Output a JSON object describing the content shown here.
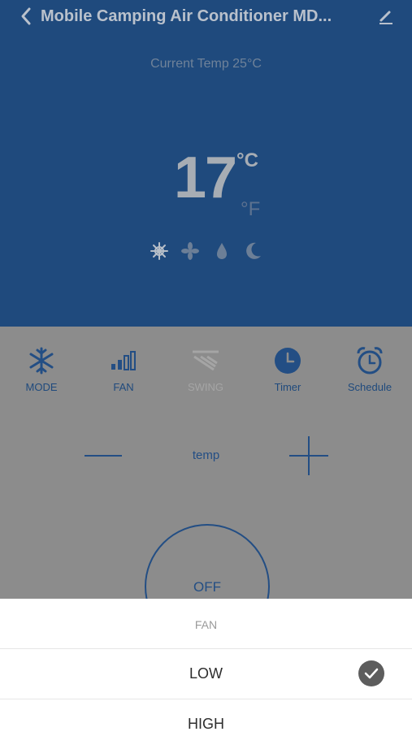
{
  "header": {
    "title": "Mobile Camping Air Conditioner MD...",
    "back_icon": "chevron-left-icon",
    "edit_icon": "pencil-icon"
  },
  "status": {
    "current_temp": "Current Temp 25°C",
    "set_temp": "17",
    "unit_c": "°C",
    "unit_f": "°F",
    "mode_icons": [
      "snowflake-icon",
      "fan-icon",
      "droplet-icon",
      "moon-icon"
    ]
  },
  "controls": [
    {
      "label": "MODE",
      "icon": "snowflake-icon"
    },
    {
      "label": "FAN",
      "icon": "signal-bars-icon"
    },
    {
      "label": "SWING",
      "icon": "swing-icon"
    },
    {
      "label": "Timer",
      "icon": "clock-icon"
    },
    {
      "label": "Schedule",
      "icon": "alarm-icon"
    }
  ],
  "temp_control": {
    "label": "temp"
  },
  "power": {
    "label": "OFF"
  },
  "fan_sheet": {
    "title": "FAN",
    "options": [
      {
        "label": "LOW",
        "selected": true
      },
      {
        "label": "HIGH",
        "selected": false
      }
    ]
  },
  "colors": {
    "hero_blue": "#1f4a7d",
    "accent_blue": "#234e84",
    "overlay_gray": "#8c8c8c"
  }
}
